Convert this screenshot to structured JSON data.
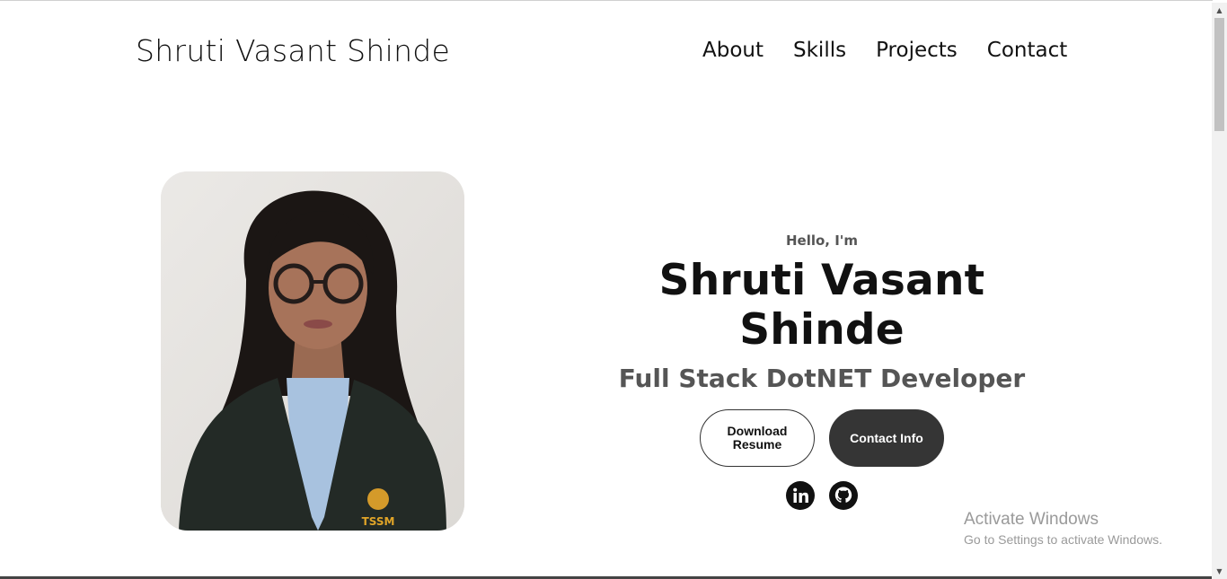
{
  "header": {
    "logo": "Shruti Vasant Shinde",
    "nav": [
      "About",
      "Skills",
      "Projects",
      "Contact"
    ]
  },
  "hero": {
    "greeting": "Hello, I'm",
    "name": "Shruti Vasant Shinde",
    "role": "Full Stack DotNET Developer",
    "buttons": {
      "download": "Download Resume",
      "contact": "Contact Info"
    },
    "socials": [
      "linkedin-icon",
      "github-icon"
    ],
    "photo_badge": "TSSM"
  },
  "watermark": {
    "title": "Activate Windows",
    "subtitle": "Go to Settings to activate Windows."
  },
  "colors": {
    "dark_button": "#353535",
    "role_text": "#555555"
  }
}
